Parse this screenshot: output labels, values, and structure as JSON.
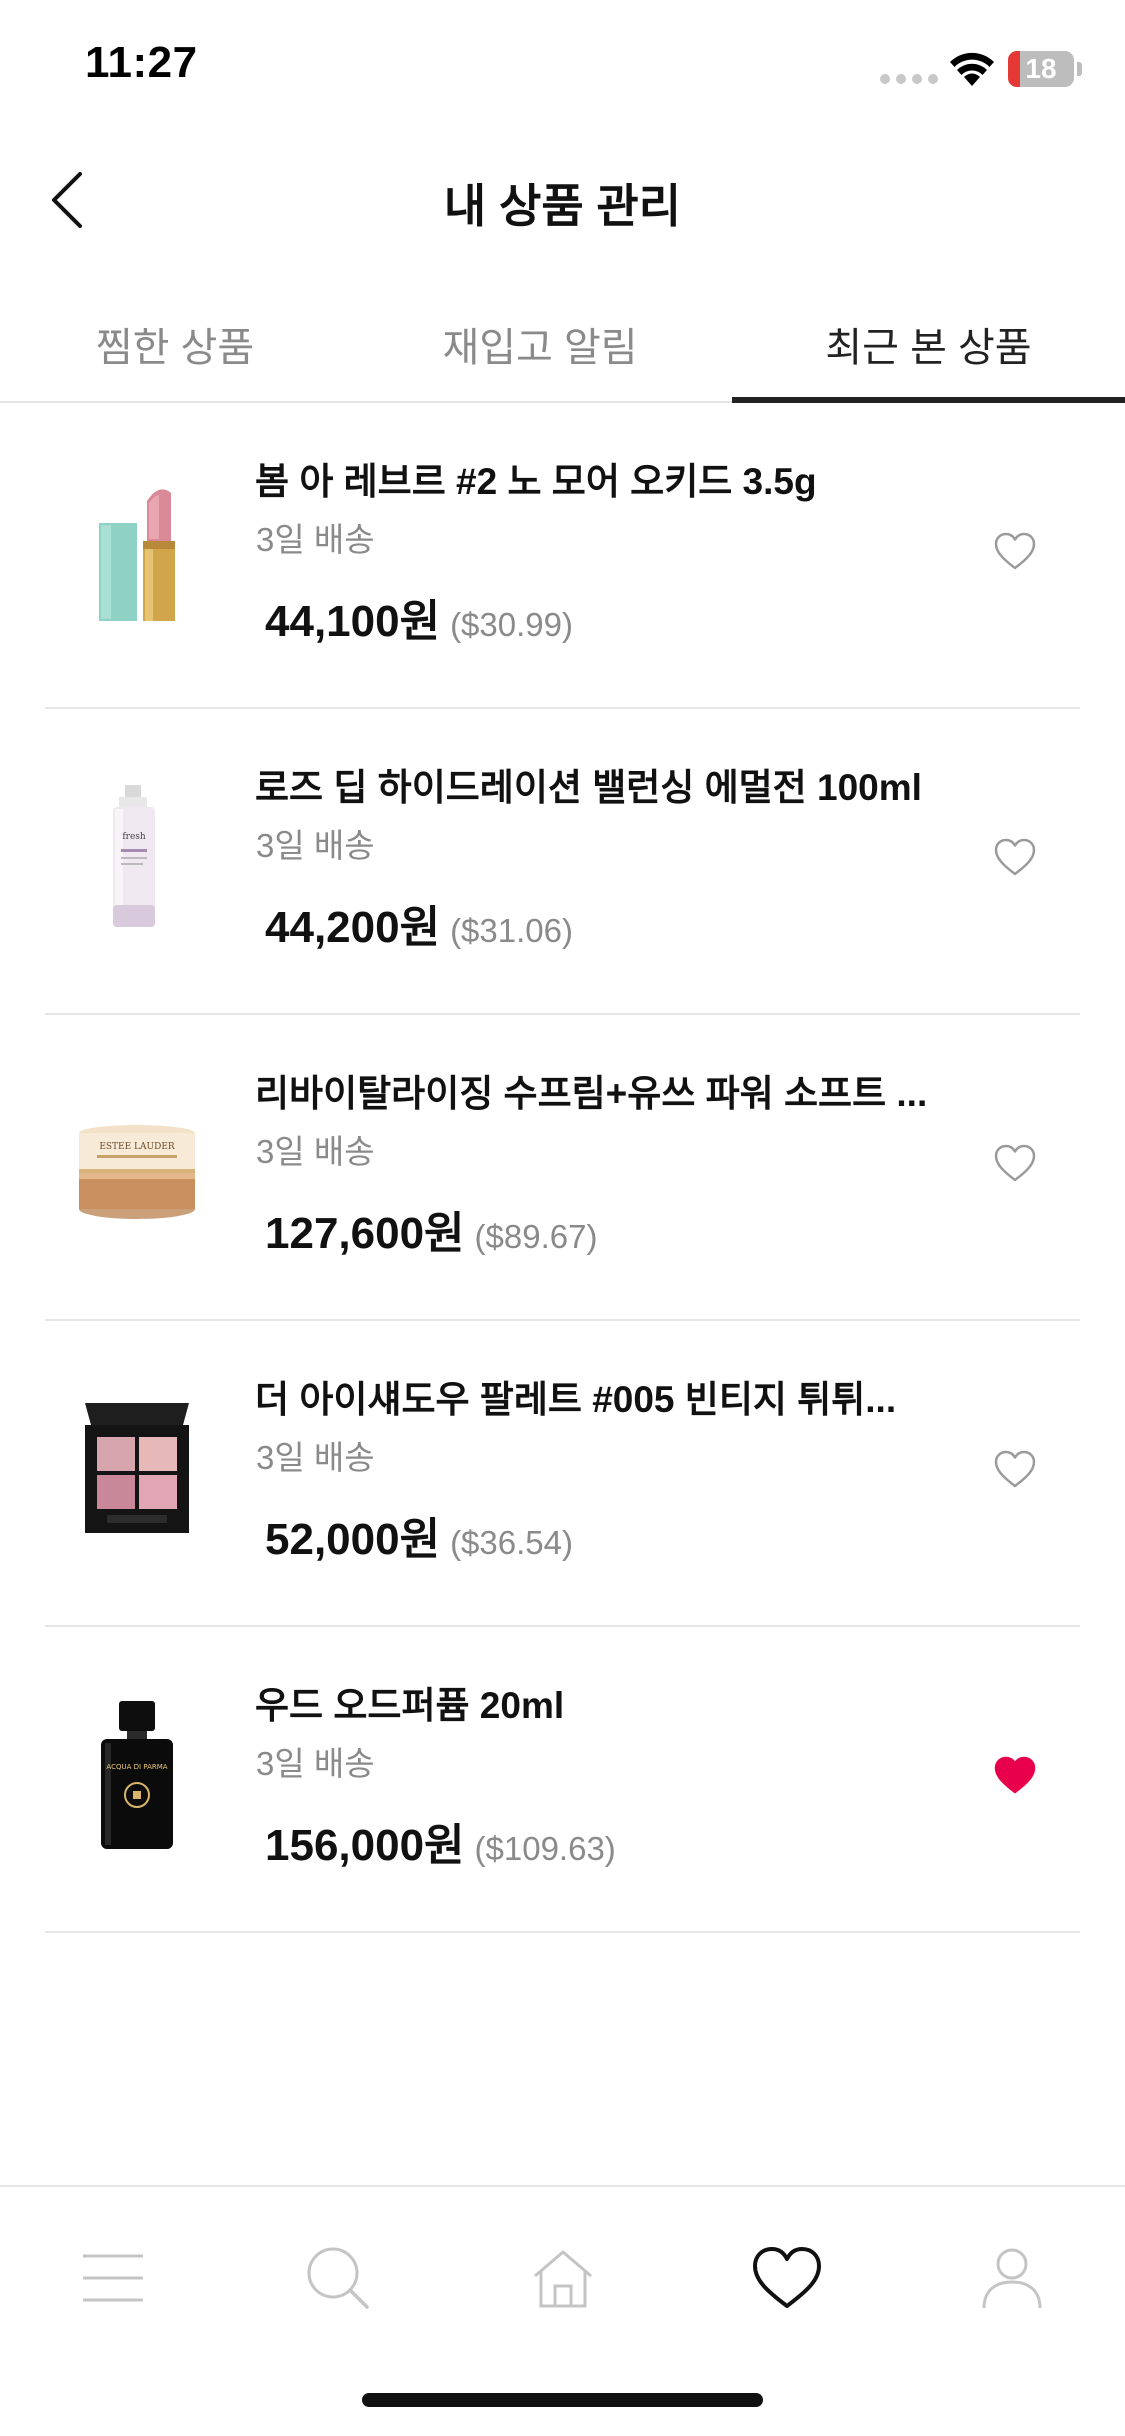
{
  "status_bar": {
    "time": "11:27",
    "battery_level": "18",
    "battery_fraction": 0.18
  },
  "header": {
    "title": "내 상품 관리",
    "back_icon": "chevron-left-icon"
  },
  "tabs": [
    {
      "label": "찜한 상품",
      "active": false
    },
    {
      "label": "재입고 알림",
      "active": false
    },
    {
      "label": "최근 본 상품",
      "active": true
    }
  ],
  "products": [
    {
      "name": "봄 아 레브르 #2 노 모어 오키드 3.5g",
      "delivery": "3일 배송",
      "price_krw": "44,100원",
      "price_usd": "($30.99)",
      "wished": false
    },
    {
      "name": "로즈 딥 하이드레이션 밸런싱 에멀전 100ml",
      "delivery": "3일 배송",
      "price_krw": "44,200원",
      "price_usd": "($31.06)",
      "wished": false
    },
    {
      "name": "리바이탈라이징 수프림+유쓰 파워 소프트 ...",
      "delivery": "3일 배송",
      "price_krw": "127,600원",
      "price_usd": "($89.67)",
      "wished": false
    },
    {
      "name": "더 아이섀도우 팔레트 #005 빈티지 튀튀...",
      "delivery": "3일 배송",
      "price_krw": "52,000원",
      "price_usd": "($36.54)",
      "wished": false
    },
    {
      "name": "우드 오드퍼퓸 20ml",
      "delivery": "3일 배송",
      "price_krw": "156,000원",
      "price_usd": "($109.63)",
      "wished": true
    }
  ],
  "product_images": [
    {
      "icon": "lipstick-image",
      "label": ""
    },
    {
      "icon": "emulsion-bottle-image",
      "label": "fresh"
    },
    {
      "icon": "cream-jar-image",
      "label": "ESTEE LAUDER"
    },
    {
      "icon": "eyeshadow-palette-image",
      "label": ""
    },
    {
      "icon": "perfume-bottle-image",
      "label": "ACQUA DI PARMA"
    }
  ],
  "bottom_nav": [
    {
      "icon": "menu-icon",
      "active": false
    },
    {
      "icon": "search-icon",
      "active": false
    },
    {
      "icon": "home-icon",
      "active": false
    },
    {
      "icon": "heart-icon",
      "active": true
    },
    {
      "icon": "user-icon",
      "active": false
    }
  ],
  "colors": {
    "accent": "#e8004c",
    "text_primary": "#111111",
    "text_secondary": "#8a8a8a",
    "divider": "#e6e6e6",
    "inactive_icon": "#bdbdbd"
  }
}
